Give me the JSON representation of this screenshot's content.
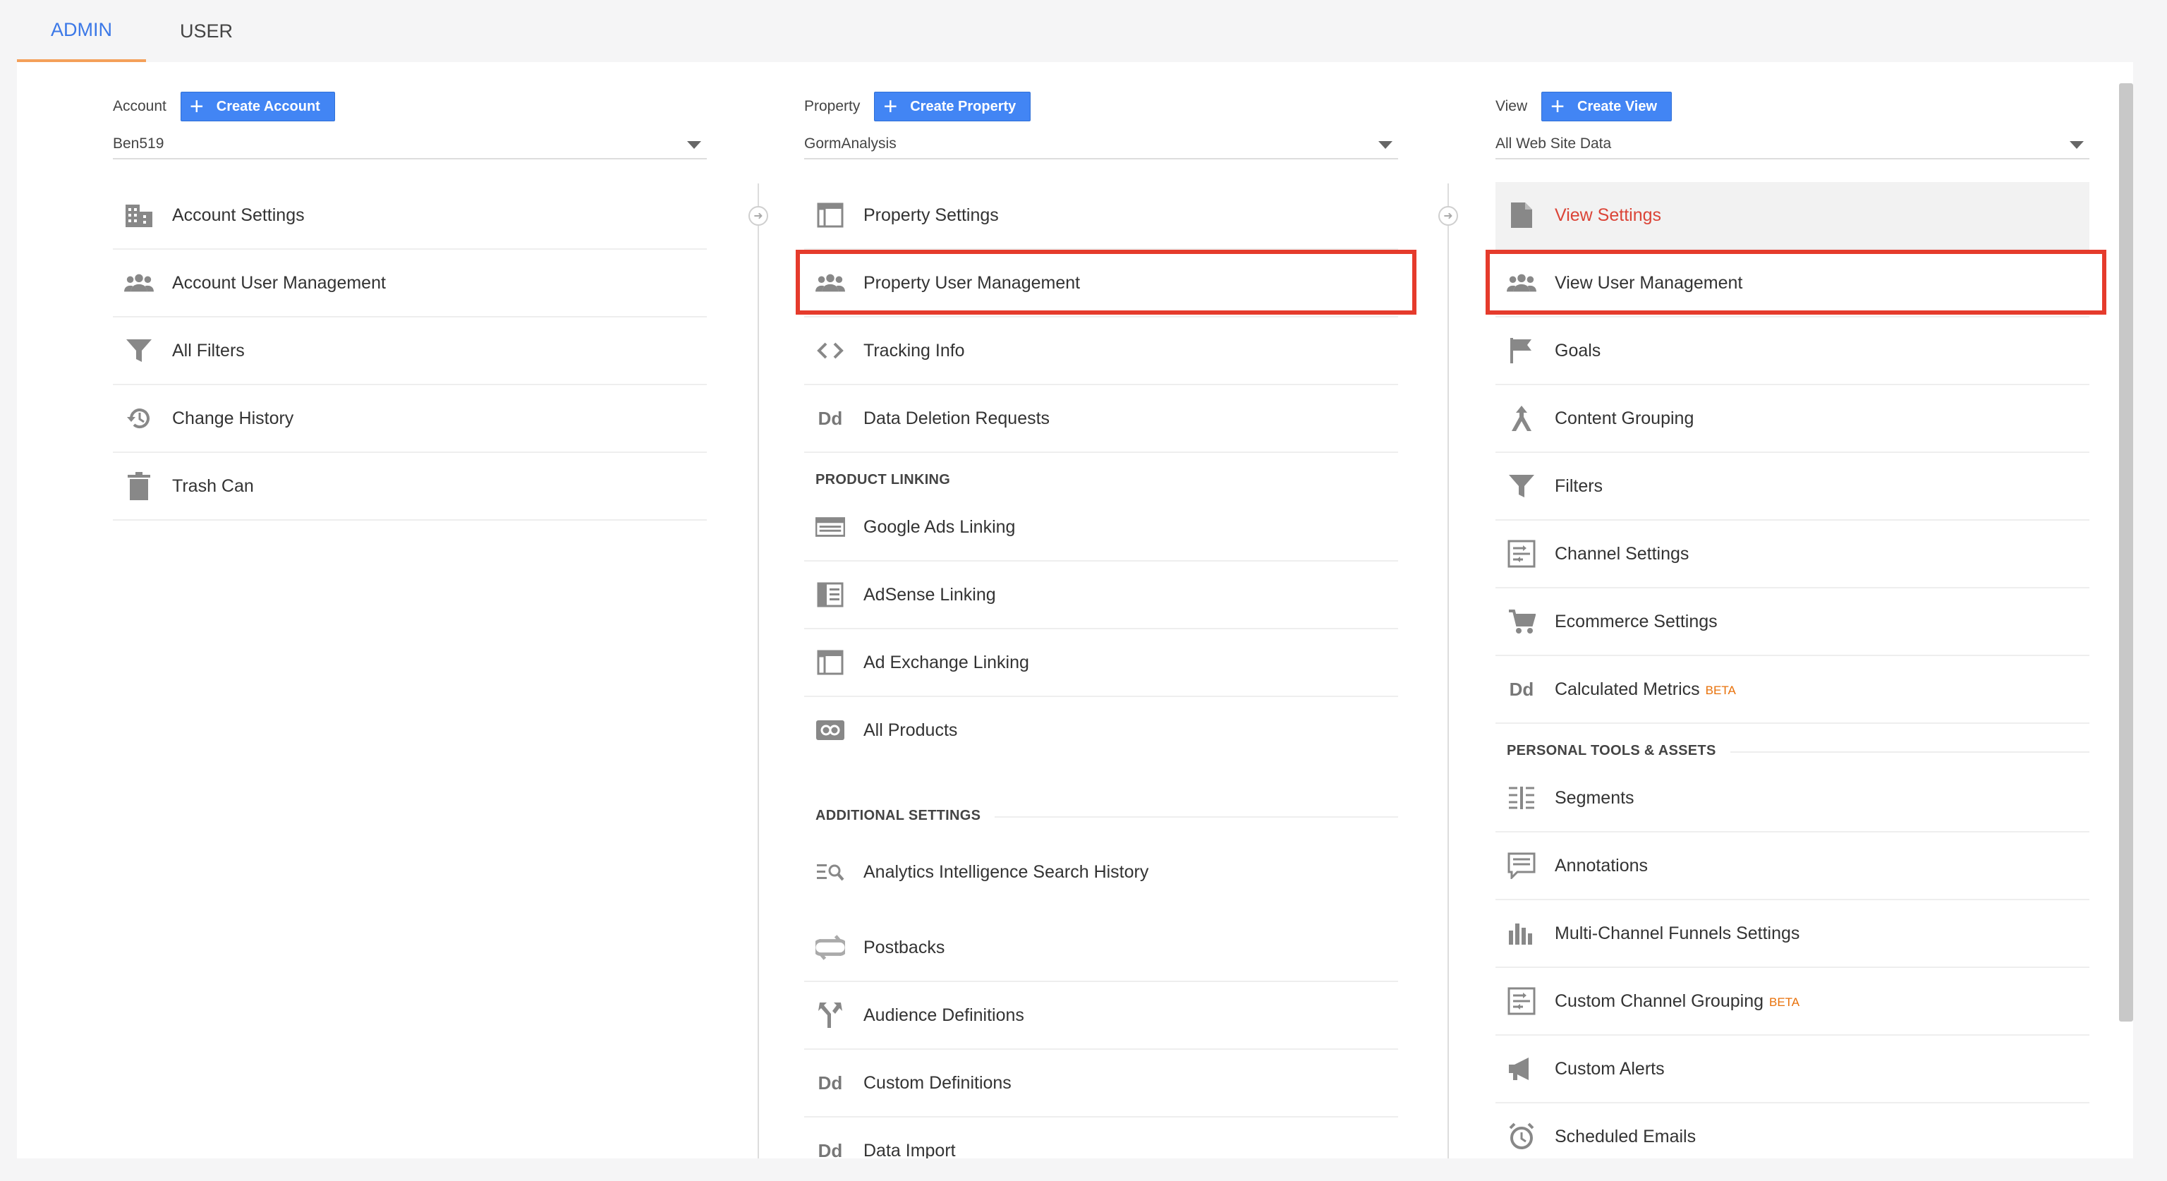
{
  "tabs": [
    {
      "label": "ADMIN",
      "active": true
    },
    {
      "label": "USER",
      "active": false
    }
  ],
  "colors": {
    "accent": "#4285f4",
    "highlight": "#e53b2c",
    "selected_text": "#db4437",
    "beta": "#e8710a"
  },
  "account": {
    "label": "Account",
    "create_label": "Create Account",
    "selected": "Ben519",
    "items": [
      {
        "label": "Account Settings",
        "icon": "building-icon"
      },
      {
        "label": "Account User Management",
        "icon": "people-icon"
      },
      {
        "label": "All Filters",
        "icon": "filter-icon"
      },
      {
        "label": "Change History",
        "icon": "history-icon"
      },
      {
        "label": "Trash Can",
        "icon": "trash-icon"
      }
    ]
  },
  "property": {
    "label": "Property",
    "create_label": "Create Property",
    "selected": "GormAnalysis",
    "items": [
      {
        "label": "Property Settings",
        "icon": "layout-icon"
      },
      {
        "label": "Property User Management",
        "icon": "people-icon"
      },
      {
        "label": "Tracking Info",
        "icon": "code-icon"
      },
      {
        "label": "Data Deletion Requests",
        "icon": "dd-icon"
      }
    ],
    "product_linking_title": "PRODUCT LINKING",
    "product_linking": [
      {
        "label": "Google Ads Linking",
        "icon": "ads-icon"
      },
      {
        "label": "AdSense Linking",
        "icon": "adsense-icon"
      },
      {
        "label": "Ad Exchange Linking",
        "icon": "layout-icon"
      },
      {
        "label": "All Products",
        "icon": "link-icon"
      }
    ],
    "additional_title": "ADDITIONAL SETTINGS",
    "additional": [
      {
        "label": "Analytics Intelligence Search History",
        "icon": "search-list-icon"
      },
      {
        "label": "Postbacks",
        "icon": "postback-icon"
      },
      {
        "label": "Audience Definitions",
        "icon": "fork-icon"
      },
      {
        "label": "Custom Definitions",
        "icon": "dd-icon"
      },
      {
        "label": "Data Import",
        "icon": "dd-icon"
      }
    ]
  },
  "view": {
    "label": "View",
    "create_label": "Create View",
    "selected": "All Web Site Data",
    "items": [
      {
        "label": "View Settings",
        "icon": "document-icon"
      },
      {
        "label": "View User Management",
        "icon": "people-icon"
      },
      {
        "label": "Goals",
        "icon": "flag-icon"
      },
      {
        "label": "Content Grouping",
        "icon": "grouping-icon"
      },
      {
        "label": "Filters",
        "icon": "filter-icon"
      },
      {
        "label": "Channel Settings",
        "icon": "channel-icon"
      },
      {
        "label": "Ecommerce Settings",
        "icon": "cart-icon"
      },
      {
        "label": "Calculated Metrics",
        "icon": "dd-icon",
        "badge": "BETA"
      }
    ],
    "personal_title": "PERSONAL TOOLS & ASSETS",
    "personal": [
      {
        "label": "Segments",
        "icon": "segments-icon"
      },
      {
        "label": "Annotations",
        "icon": "comment-icon"
      },
      {
        "label": "Multi-Channel Funnels Settings",
        "icon": "bars-icon"
      },
      {
        "label": "Custom Channel Grouping",
        "icon": "channel-icon",
        "badge": "BETA"
      },
      {
        "label": "Custom Alerts",
        "icon": "megaphone-icon"
      },
      {
        "label": "Scheduled Emails",
        "icon": "clock-icon"
      }
    ]
  }
}
